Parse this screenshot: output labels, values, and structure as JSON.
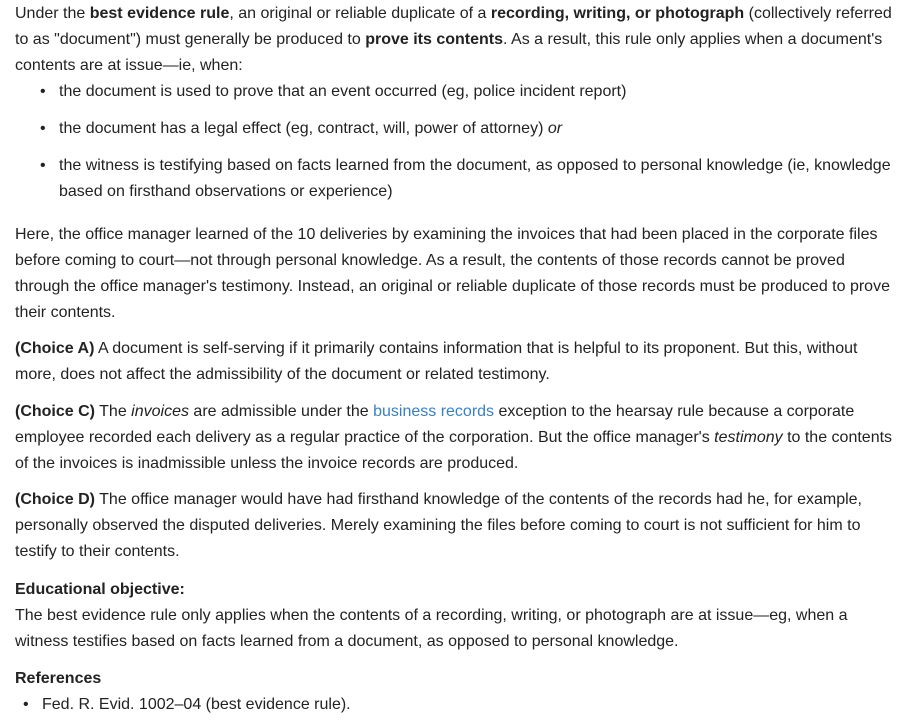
{
  "intro": {
    "t1": "Under the ",
    "b1": "best evidence rule",
    "t2": ", an original or reliable duplicate of a ",
    "b2": "recording, writing, or photograph",
    "t3": " (collectively referred to as \"document\") must generally be produced to ",
    "b3": "prove its contents",
    "t4": ".  As a result, this rule only applies when a document's contents are at issue—ie, when:"
  },
  "bullets": [
    {
      "text": "the document is used to prove that an event occurred (eg, police incident report)"
    },
    {
      "text": "the document has a legal effect (eg, contract, will, power of attorney) ",
      "ital": "or"
    },
    {
      "text": "the witness is testifying based on facts learned from the document, as opposed to personal knowledge (ie, knowledge based on firsthand observations or experience)"
    }
  ],
  "explanation": "Here, the office manager learned of the 10 deliveries by examining the invoices that had been placed in the corporate files before coming to court—not through personal knowledge.  As a result, the contents of those records cannot be proved through the office manager's testimony.  Instead, an original or reliable duplicate of those records must be produced to prove their contents.",
  "choice_a": {
    "label": "(Choice A)",
    "text": " A document is self-serving if it primarily contains information that is helpful to its proponent.  But this, without more, does not affect the admissibility of the document or related testimony."
  },
  "choice_c": {
    "label": "(Choice C)",
    "t1": " The ",
    "i1": "invoices",
    "t2": " are admissible under the ",
    "link": "business records",
    "t3": " exception to the hearsay rule because a corporate employee recorded each delivery as a regular practice of the corporation.  But the office manager's ",
    "i2": "testimony",
    "t4": " to the contents of the invoices is inadmissible unless the invoice records are produced."
  },
  "choice_d": {
    "label": "(Choice D)",
    "text": " The office manager would have had firsthand knowledge of the contents of the records had he, for example, personally observed the disputed deliveries.  Merely examining the files before coming to court is not sufficient for him to testify to their contents."
  },
  "objective": {
    "heading": "Educational objective:",
    "text": "The best evidence rule only applies when the contents of a recording, writing, or photograph are at issue—eg, when a witness testifies based on facts learned from a document, as opposed to personal knowledge."
  },
  "references": {
    "heading": "References",
    "items": [
      "Fed. R. Evid. 1002–04 (best evidence rule)."
    ]
  },
  "colors": {
    "text": "#222222",
    "link": "#3a7fc4"
  }
}
